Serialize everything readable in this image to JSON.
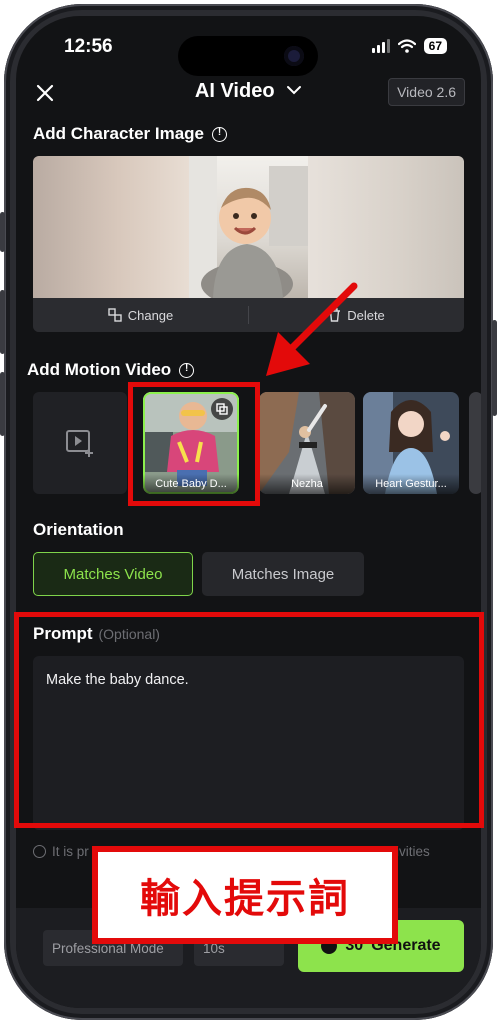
{
  "status_bar": {
    "time": "12:56",
    "battery": "67"
  },
  "header": {
    "title": "AI Video",
    "version": "Video 2.6"
  },
  "character": {
    "title": "Add Character Image",
    "change_label": "Change",
    "delete_label": "Delete"
  },
  "motion": {
    "title": "Add Motion Video",
    "items": [
      {
        "label": "Cute Baby D..."
      },
      {
        "label": "Nezha"
      },
      {
        "label": "Heart Gestur..."
      }
    ]
  },
  "orientation": {
    "title": "Orientation",
    "options": [
      {
        "label": "Matches Video",
        "selected": true
      },
      {
        "label": "Matches Image",
        "selected": false
      }
    ]
  },
  "prompt": {
    "title": "Prompt",
    "optional": "(Optional)",
    "value": "Make the baby dance."
  },
  "notice": {
    "left": "It is pr",
    "right": "activities"
  },
  "bottom": {
    "mode_label": "Professional Mode",
    "count_label": "10s",
    "credits": "30",
    "generate_label": "Generate"
  },
  "annotation": {
    "caption": "輸入提示詞"
  },
  "colors": {
    "accent": "#8de34c",
    "highlight": "#e30a0a",
    "background": "#121315"
  }
}
